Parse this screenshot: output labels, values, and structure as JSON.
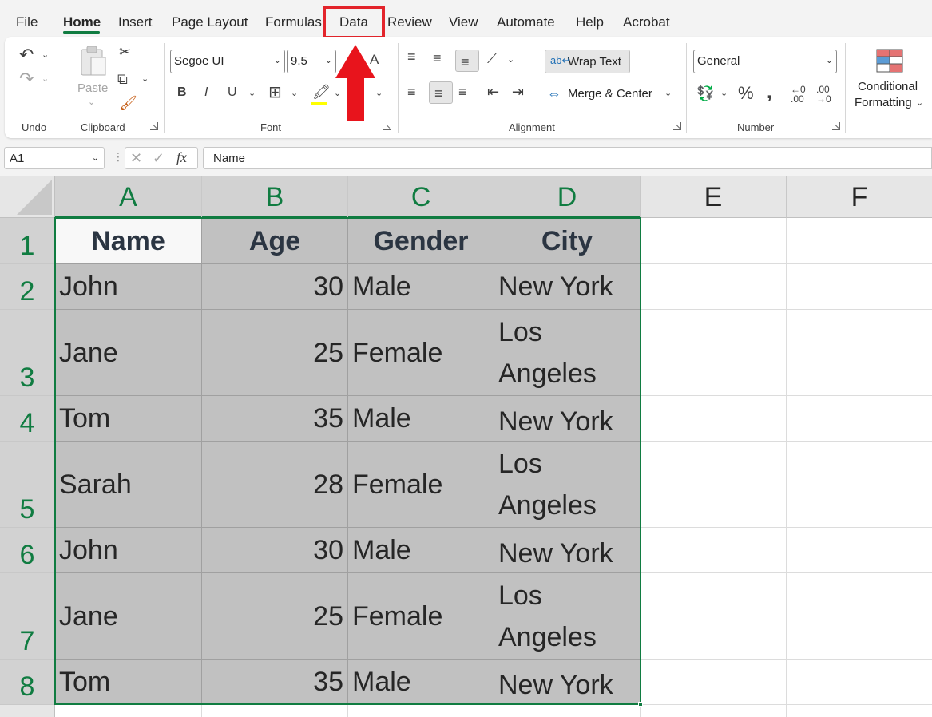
{
  "menu": {
    "tabs": [
      "File",
      "Home",
      "Insert",
      "Page Layout",
      "Formulas",
      "Data",
      "Review",
      "View",
      "Automate",
      "Help",
      "Acrobat"
    ],
    "active_tab": "Home",
    "highlighted_tab": "Data"
  },
  "ribbon": {
    "undo": {
      "label": "Undo"
    },
    "clipboard": {
      "label": "Clipboard",
      "paste_label": "Paste"
    },
    "font": {
      "label": "Font",
      "font_name": "Segoe UI",
      "font_size": "9.5"
    },
    "alignment": {
      "label": "Alignment",
      "wrap_text": "Wrap Text",
      "merge_center": "Merge & Center"
    },
    "number": {
      "label": "Number",
      "format": "General"
    },
    "styles": {
      "conditional_formatting_line1": "Conditional",
      "conditional_formatting_line2": "Formatting"
    }
  },
  "formula_bar": {
    "name_box": "A1",
    "content": "Name",
    "fx": "fx"
  },
  "sheet": {
    "columns": [
      "A",
      "B",
      "C",
      "D",
      "E",
      "F"
    ],
    "rows": [
      "1",
      "2",
      "3",
      "4",
      "5",
      "6",
      "7",
      "8"
    ],
    "header": [
      "Name",
      "Age",
      "Gender",
      "City"
    ],
    "data": [
      [
        "John",
        "30",
        "Male",
        "New York"
      ],
      [
        "Jane",
        "25",
        "Female",
        "Los Angeles"
      ],
      [
        "Tom",
        "35",
        "Male",
        "New York"
      ],
      [
        "Sarah",
        "28",
        "Female",
        "Los Angeles"
      ],
      [
        "John",
        "30",
        "Male",
        "New York"
      ],
      [
        "Jane",
        "25",
        "Female",
        "Los Angeles"
      ],
      [
        "Tom",
        "35",
        "Male",
        "New York"
      ]
    ]
  },
  "colors": {
    "accent": "#107c41",
    "highlight": "#e3242b",
    "selection_fill": "#c1c1c1"
  },
  "annotation": {
    "shape": "red-up-arrow",
    "target": "Data"
  }
}
